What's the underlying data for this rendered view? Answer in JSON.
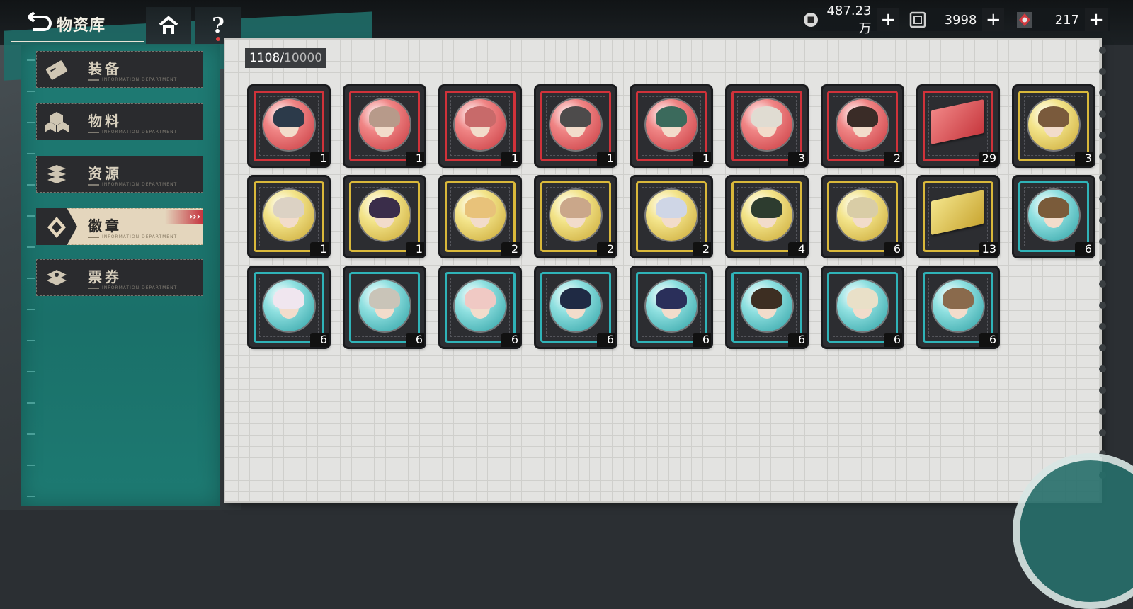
{
  "header": {
    "title": "物资库",
    "help_label": "?"
  },
  "currencies": [
    {
      "icon": "coin-icon",
      "value": "487.23万"
    },
    {
      "icon": "tile-icon",
      "value": "3998"
    },
    {
      "icon": "crystal-icon",
      "value": "217"
    }
  ],
  "plus_label": "+",
  "sidebar": {
    "items": [
      {
        "label": "装备",
        "sub": "INFORMATION DEPARTMENT",
        "icon": "equipment-card-icon",
        "active": false
      },
      {
        "label": "物料",
        "sub": "INFORMATION DEPARTMENT",
        "icon": "materials-cubes-icon",
        "active": false
      },
      {
        "label": "资源",
        "sub": "INFORMATION DEPARTMENT",
        "icon": "resources-stack-icon",
        "active": false
      },
      {
        "label": "徽章",
        "sub": "INFORMATION DEPARTMENT",
        "icon": "badge-icon",
        "active": true
      },
      {
        "label": "票券",
        "sub": "INFORMATION DEPARTMENT",
        "icon": "ticket-icon",
        "active": false
      }
    ],
    "active_chevrons": "›››"
  },
  "inventory": {
    "count": "1108",
    "separator": "/",
    "capacity": "10000"
  },
  "colors": {
    "red": "#d0323a",
    "gold": "#d9b83a",
    "teal": "#2fb3b8",
    "sidebar_teal": "#1f7b74"
  },
  "items": [
    {
      "rarity": "red",
      "type": "badge",
      "qty": "1"
    },
    {
      "rarity": "red",
      "type": "badge",
      "qty": "1"
    },
    {
      "rarity": "red",
      "type": "badge",
      "qty": "1"
    },
    {
      "rarity": "red",
      "type": "badge",
      "qty": "1"
    },
    {
      "rarity": "red",
      "type": "badge",
      "qty": "1"
    },
    {
      "rarity": "red",
      "type": "badge",
      "qty": "3"
    },
    {
      "rarity": "red",
      "type": "badge",
      "qty": "2"
    },
    {
      "rarity": "red",
      "type": "ticket",
      "qty": "29"
    },
    {
      "rarity": "gold",
      "type": "badge",
      "qty": "3"
    },
    {
      "rarity": "gold",
      "type": "badge",
      "qty": "1"
    },
    {
      "rarity": "gold",
      "type": "badge",
      "qty": "1"
    },
    {
      "rarity": "gold",
      "type": "badge",
      "qty": "2"
    },
    {
      "rarity": "gold",
      "type": "badge",
      "qty": "2"
    },
    {
      "rarity": "gold",
      "type": "badge",
      "qty": "2"
    },
    {
      "rarity": "gold",
      "type": "badge",
      "qty": "4"
    },
    {
      "rarity": "gold",
      "type": "badge",
      "qty": "6"
    },
    {
      "rarity": "gold",
      "type": "ticket",
      "qty": "13"
    },
    {
      "rarity": "teal",
      "type": "badge",
      "qty": "6"
    },
    {
      "rarity": "teal",
      "type": "badge",
      "qty": "6"
    },
    {
      "rarity": "teal",
      "type": "badge",
      "qty": "6"
    },
    {
      "rarity": "teal",
      "type": "badge",
      "qty": "6"
    },
    {
      "rarity": "teal",
      "type": "badge",
      "qty": "6"
    },
    {
      "rarity": "teal",
      "type": "badge",
      "qty": "6"
    },
    {
      "rarity": "teal",
      "type": "badge",
      "qty": "6"
    },
    {
      "rarity": "teal",
      "type": "badge",
      "qty": "6"
    },
    {
      "rarity": "teal",
      "type": "badge",
      "qty": "6"
    }
  ]
}
